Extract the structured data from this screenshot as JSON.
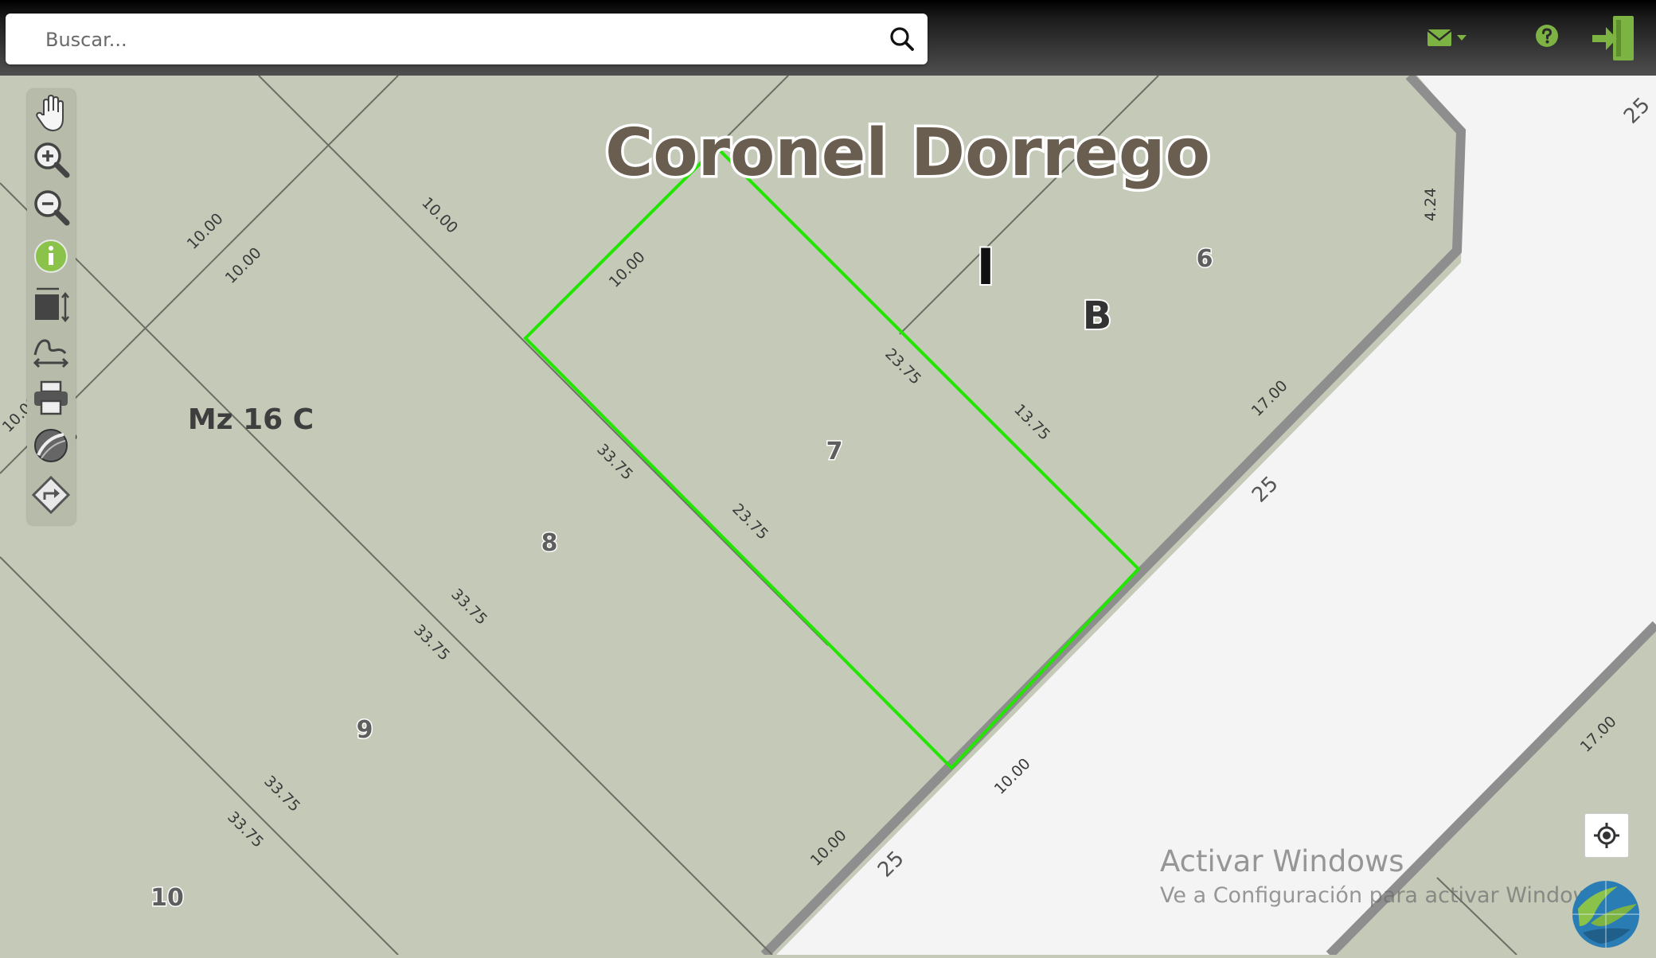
{
  "search": {
    "placeholder": "Buscar..."
  },
  "topbar": {
    "mail_icon": "envelope-dropdown-icon",
    "help_icon": "question-circle-icon",
    "logout_icon": "exit-door-icon",
    "accent_color": "#8bc34a"
  },
  "map": {
    "street_title": "Coronel Dorrego",
    "block_label": "Mz 16 C",
    "section_label": "B",
    "section_mark": "I",
    "street_number": "25",
    "lot_numbers": [
      "6",
      "7",
      "8",
      "9",
      "10"
    ],
    "dimensions": {
      "d_1000": "10.00",
      "d_3375": "33.75",
      "d_2375": "23.75",
      "d_1375": "13.75",
      "d_1700": "17.00",
      "d_424": "4.24"
    },
    "selection_color": "#22e600"
  },
  "toolbar": {
    "tools": [
      "pan-hand-icon",
      "zoom-in-icon",
      "zoom-out-icon",
      "info-icon",
      "zoom-extent-icon",
      "measure-icon",
      "print-icon",
      "layers-globe-icon",
      "directions-icon"
    ]
  },
  "watermark": {
    "line1": "Activar Windows",
    "line2": "Ve a Configuración para activar Windows."
  }
}
